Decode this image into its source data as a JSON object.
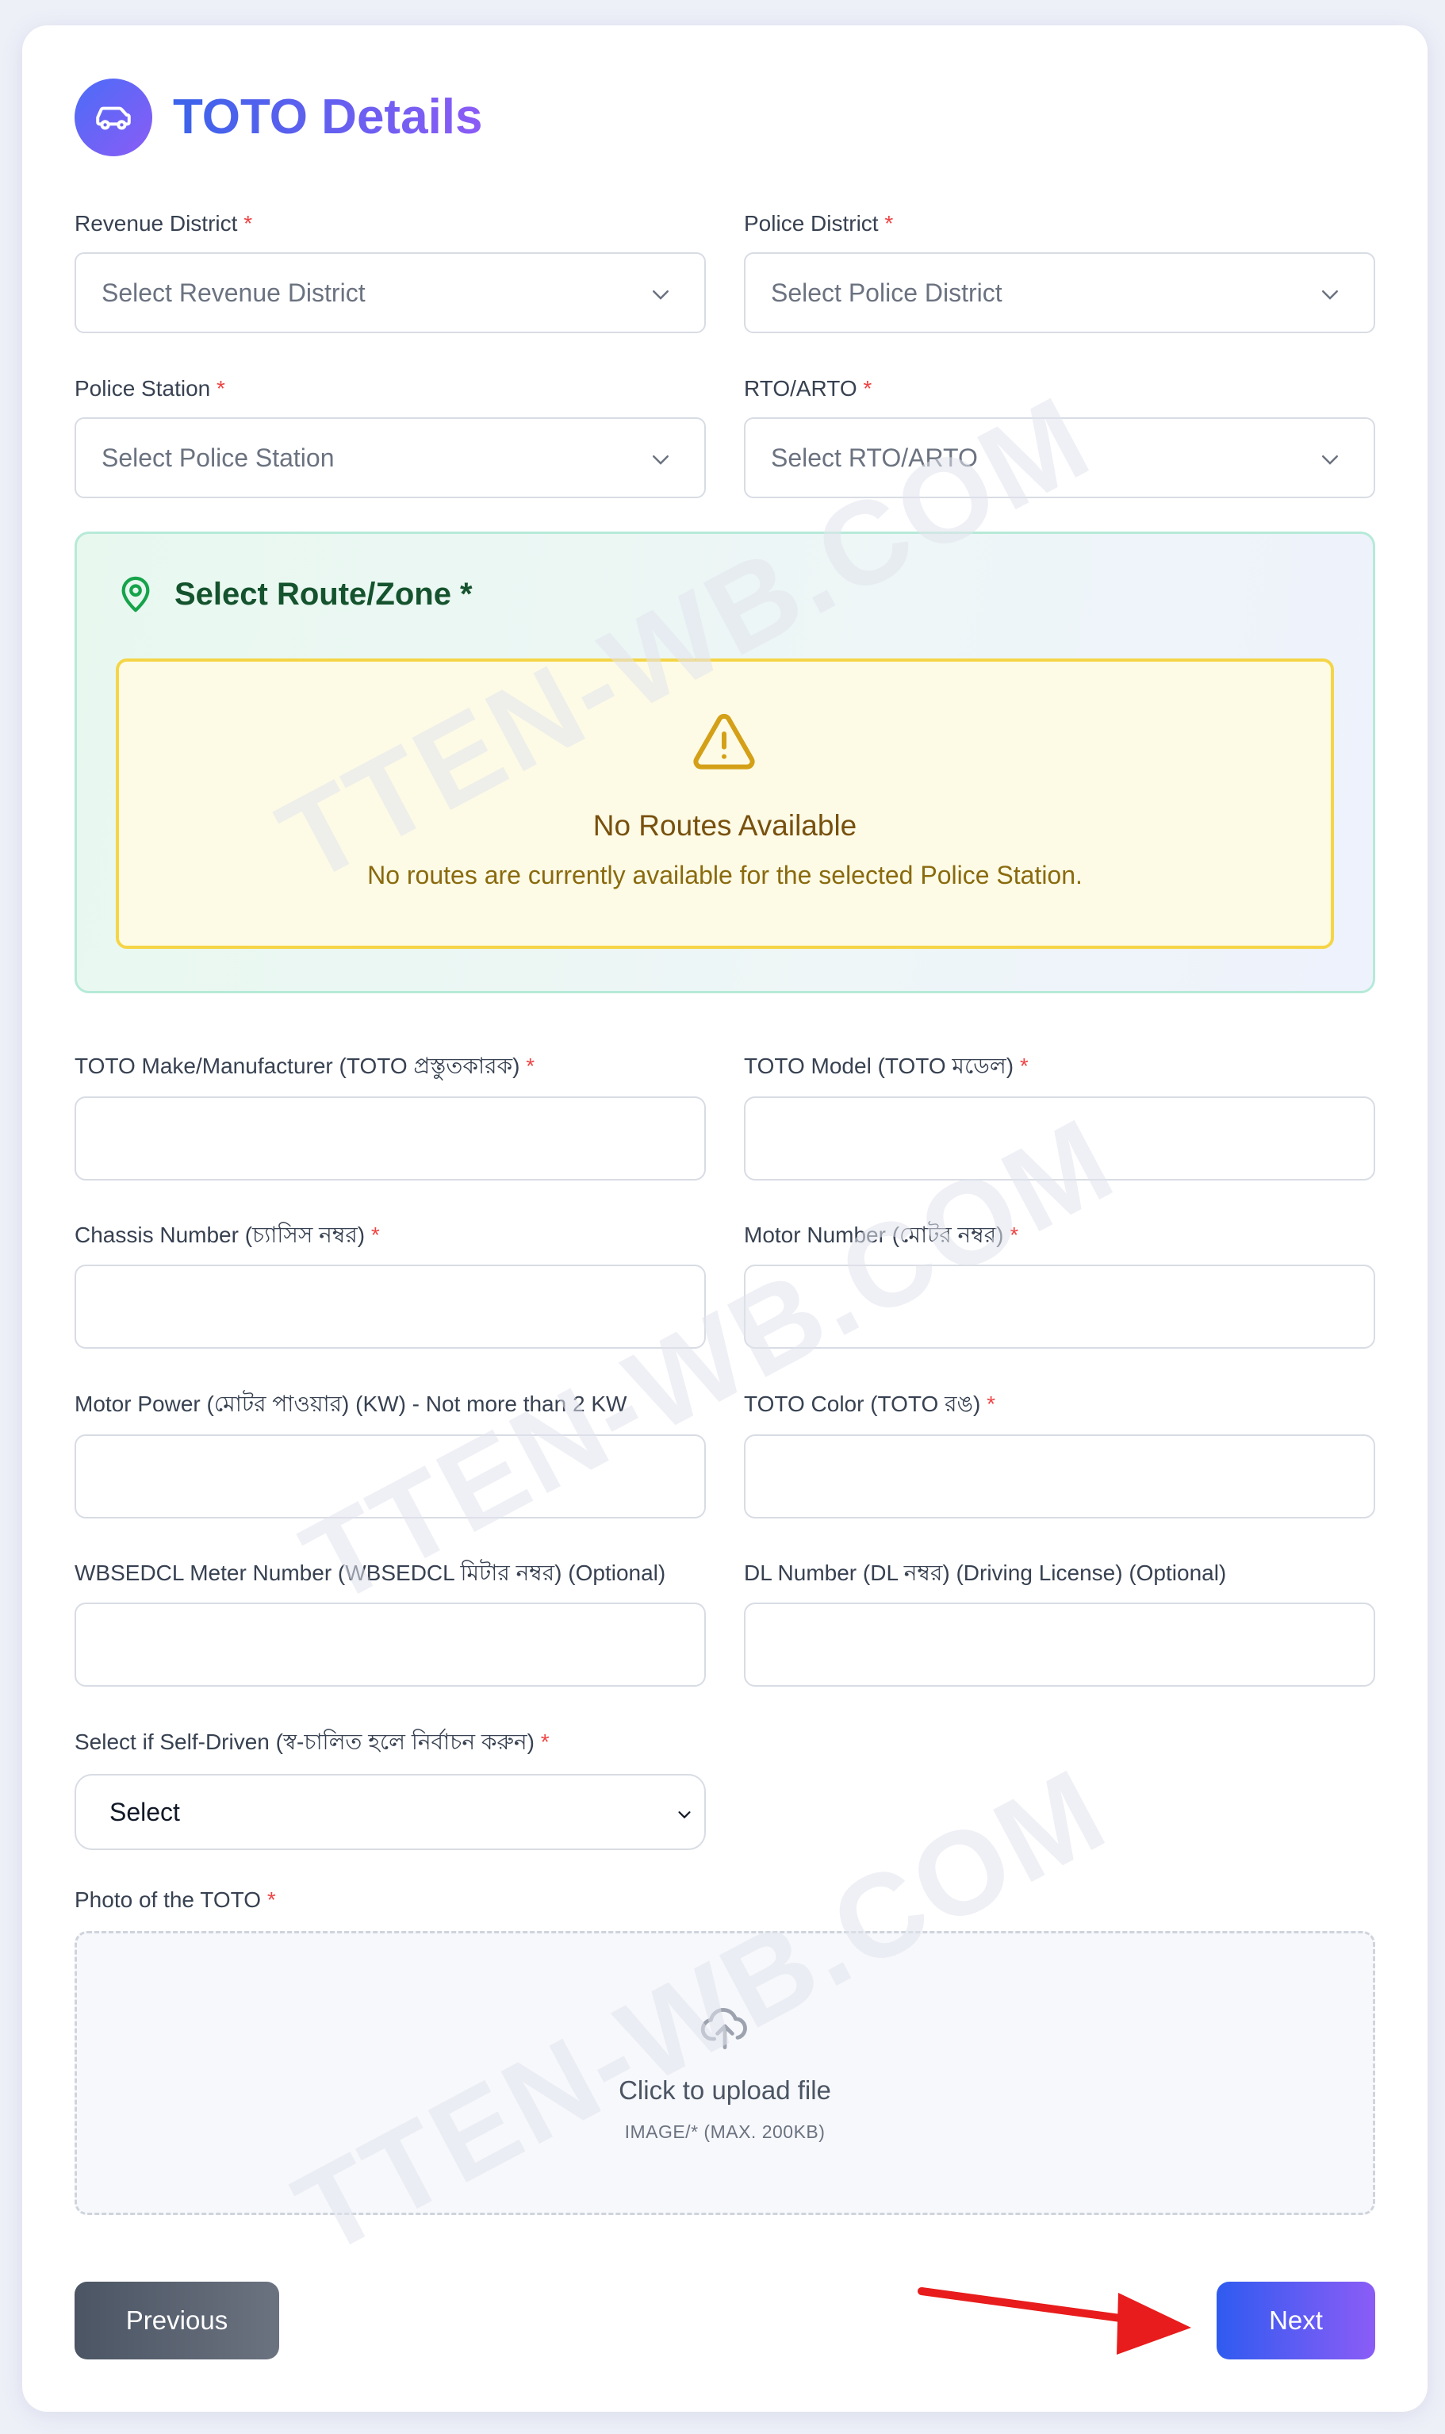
{
  "header": {
    "title": "TOTO Details",
    "icon": "car-icon"
  },
  "fields": {
    "revenue_district": {
      "label": "Revenue District",
      "placeholder": "Select Revenue District"
    },
    "police_district": {
      "label": "Police District",
      "placeholder": "Select Police District"
    },
    "police_station": {
      "label": "Police Station",
      "placeholder": "Select Police Station"
    },
    "rto_arto": {
      "label": "RTO/ARTO",
      "placeholder": "Select RTO/ARTO"
    },
    "make": {
      "label": "TOTO Make/Manufacturer (TOTO প্রস্তুতকারক)",
      "value": ""
    },
    "model": {
      "label": "TOTO Model (TOTO মডেল)",
      "value": ""
    },
    "chassis": {
      "label": "Chassis Number (চ্যাসিস নম্বর)",
      "value": ""
    },
    "motor_number": {
      "label": "Motor Number (মোটর নম্বর)",
      "value": ""
    },
    "motor_power": {
      "label": "Motor Power (মোটর পাওয়ার) (KW) - Not more than 2 KW",
      "value": ""
    },
    "color": {
      "label": "TOTO Color (TOTO রঙ)",
      "value": ""
    },
    "meter": {
      "label": "WBSEDCL Meter Number (WBSEDCL মিটার নম্বর) (Optional)",
      "value": ""
    },
    "dl": {
      "label": "DL Number (DL নম্বর) (Driving License) (Optional)",
      "value": ""
    },
    "self_driven": {
      "label": "Select if Self-Driven (স্ব-চালিত হলে নির্বাচন করুন)",
      "selected": "Select"
    },
    "photo": {
      "label": "Photo of the TOTO"
    }
  },
  "required_mark": "*",
  "route": {
    "title": "Select Route/Zone *",
    "warning_title": "No Routes Available",
    "warning_text": "No routes are currently available for the selected Police Station."
  },
  "upload": {
    "title": "Click to upload file",
    "hint": "IMAGE/* (MAX. 200KB)"
  },
  "buttons": {
    "previous": "Previous",
    "next": "Next"
  },
  "watermark": "TTEN-WB.COM",
  "colors": {
    "accent_start": "#3b63ea",
    "accent_end": "#8b5cf6",
    "required": "#ef4444",
    "route_title": "#14532d",
    "warning_border": "#f5d547",
    "annotation_arrow": "#e81c1c"
  }
}
